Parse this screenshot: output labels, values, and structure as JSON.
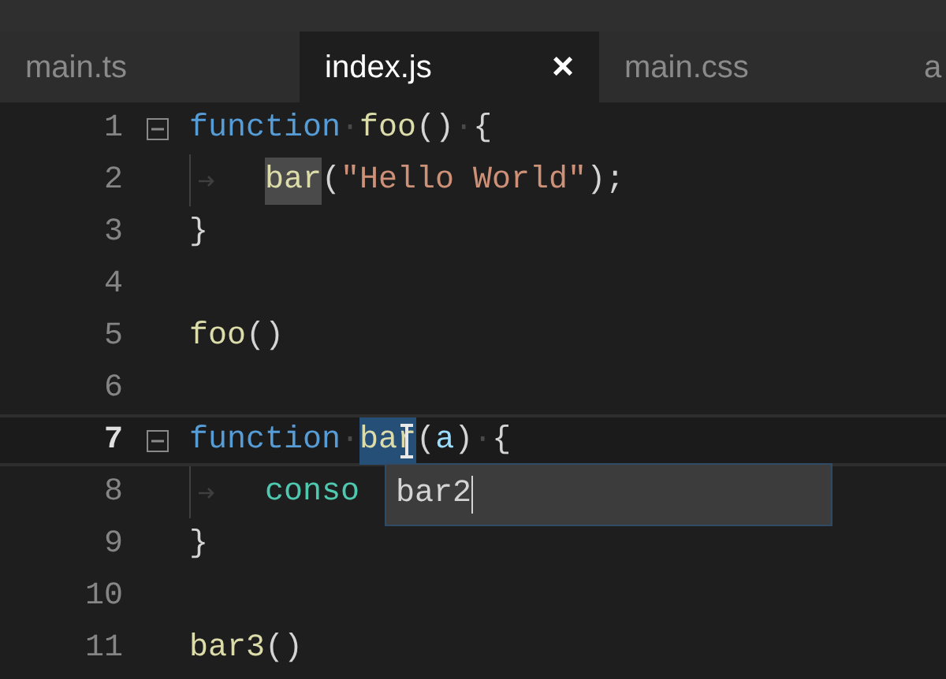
{
  "tabs": [
    {
      "label": "main.ts",
      "selected": false
    },
    {
      "label": "index.js",
      "selected": true,
      "close": "×"
    },
    {
      "label": "main.css",
      "selected": false
    },
    {
      "label": "a",
      "selected": false
    }
  ],
  "lines": [
    {
      "number": "1",
      "fold": true,
      "tokens": [
        {
          "text": "function",
          "kind": "keyword"
        },
        {
          "text": "·",
          "kind": "ws"
        },
        {
          "text": "foo",
          "kind": "function"
        },
        {
          "text": "()",
          "kind": "plain"
        },
        {
          "text": "·",
          "kind": "ws"
        },
        {
          "text": "{",
          "kind": "plain"
        }
      ]
    },
    {
      "number": "2",
      "indent": true,
      "tokens": [
        {
          "text": "bar",
          "kind": "function",
          "highlighted": true
        },
        {
          "text": "(",
          "kind": "plain"
        },
        {
          "text": "\"Hello World\"",
          "kind": "string"
        },
        {
          "text": ");",
          "kind": "plain"
        }
      ]
    },
    {
      "number": "3",
      "tokens": [
        {
          "text": "}",
          "kind": "plain"
        }
      ]
    },
    {
      "number": "4"
    },
    {
      "number": "5",
      "tokens": [
        {
          "text": "foo",
          "kind": "function"
        },
        {
          "text": "()",
          "kind": "plain"
        }
      ]
    },
    {
      "number": "6"
    },
    {
      "number": "7",
      "current": true,
      "fold": true,
      "tokens": [
        {
          "text": "function",
          "kind": "keyword"
        },
        {
          "text": "·",
          "kind": "ws"
        },
        {
          "text": "bar",
          "kind": "function",
          "selected": true
        },
        {
          "text": "(",
          "kind": "plain"
        },
        {
          "text": "a",
          "kind": "param"
        },
        {
          "text": ")",
          "kind": "plain"
        },
        {
          "text": "·",
          "kind": "ws"
        },
        {
          "text": "{",
          "kind": "plain"
        }
      ]
    },
    {
      "number": "8",
      "indent": true,
      "tokens": [
        {
          "text": "conso",
          "kind": "type"
        }
      ],
      "rename_box": {
        "value": "bar2"
      }
    },
    {
      "number": "9",
      "tokens": [
        {
          "text": "}",
          "kind": "plain"
        }
      ]
    },
    {
      "number": "10"
    },
    {
      "number": "11",
      "tokens": [
        {
          "text": "bar3",
          "kind": "function"
        },
        {
          "text": "()",
          "kind": "plain"
        }
      ]
    }
  ]
}
